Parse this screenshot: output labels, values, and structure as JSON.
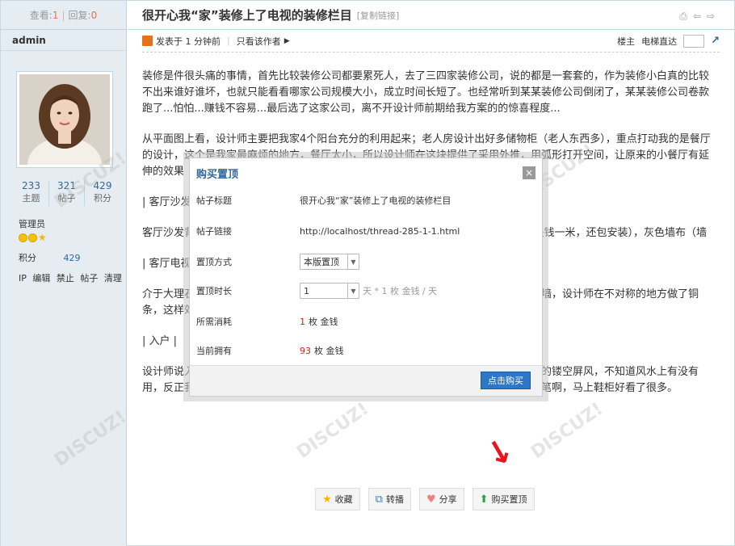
{
  "stats_bar": {
    "view_label": "查看:",
    "view_count": "1",
    "sep": "|",
    "reply_label": "回复:",
    "reply_count": "0"
  },
  "author": {
    "name": "admin"
  },
  "profile": {
    "stats": [
      {
        "value": "233",
        "label": "主题"
      },
      {
        "value": "321",
        "label": "帖子"
      },
      {
        "value": "429",
        "label": "积分"
      }
    ],
    "group": "管理员",
    "points_label": "积分",
    "points_value": "429",
    "links": [
      "IP",
      "编辑",
      "禁止",
      "帖子",
      "清理"
    ]
  },
  "thread": {
    "title": "很开心我“家”装修上了电视的装修栏目",
    "copy_link": "[复制链接]"
  },
  "meta": {
    "posted": "发表于 1 分钟前",
    "sep": "|",
    "only_author": "只看该作者",
    "floor": "楼主",
    "elevator": "电梯直达"
  },
  "content": {
    "p1": "装修是件很头痛的事情，首先比较装修公司都要累死人，去了三四家装修公司，说的都是一套套的，作为装修小白真的比较不出来谁好谁坏，也就只能看看哪家公司规模大小，成立时间长短了。也经常听到某某装修公司倒闭了，某某装修公司卷款跑了...怕怕...赚钱不容易...最后选了这家公司，离不开设计师前期给我方案的的惊喜程度...",
    "p2": "从平面图上看，设计师主要把我家4个阳台充分的利用起来；老人房设计出好多储物柜（老人东西多），重点打动我的是餐厅的设计，这个是我家最麻烦的地方，餐厅太小，所以设计师在这块提供了采用外推，用弧形打开空间，让原来的小餐厅有延伸的效果",
    "h1": "| 客厅沙发",
    "p3": "客厅沙发背景墙，设计师用了一种比较便宜的材料，效果却很好，这种材料其实40多块钱一米，还包安装），灰色墙布（墙",
    "h2": "| 客厅电视",
    "p4": "介于大理石太贵，设计师推荐我用瓷砖做电视背景墙，并且根据我的需求，改为瓷砖上墙，设计师在不对称的地方做了铜条，这样效果更好，同时避免了瓷砖与墙面连接处的收口，以及延伸了餐厅",
    "h3": "| 入户 |",
    "p5": "设计师说入户的地方空间比较小，可以做一个镂空屏风，我根据设计师的要求做了铜制的镂空屏风，不知道风水上有没有用，反正我觉得挺好看。说一下鞋柜，设计师在鞋柜的边框上嵌了铜条，我感觉点睛之笔啊，马上鞋柜好看了很多。"
  },
  "actions": [
    {
      "label": "收藏",
      "icon": "star-icon"
    },
    {
      "label": "转播",
      "icon": "share-box-icon"
    },
    {
      "label": "分享",
      "icon": "heart-icon"
    },
    {
      "label": "购买置顶",
      "icon": "up-arrow-icon"
    }
  ],
  "dialog": {
    "title": "购买置顶",
    "close": "×",
    "thread_title_label": "帖子标题",
    "thread_title_value": "很开心我“家”装修上了电视的装修栏目",
    "thread_link_label": "帖子链接",
    "thread_link_value": "http://localhost/thread-285-1-1.html",
    "mode_label": "置顶方式",
    "mode_value": "本版置顶",
    "duration_label": "置顶时长",
    "duration_value": "1",
    "duration_unit": "天 * 1 枚 金钱 / 天",
    "cost_label": "所需消耗",
    "cost_value": "1",
    "cost_unit": "枚 金钱",
    "have_label": "当前拥有",
    "have_value": "93",
    "have_unit": "枚 金钱",
    "buy_button": "点击购买"
  },
  "colors": {
    "accent": "#336699",
    "red": "#e8161a",
    "button": "#2d76c8"
  }
}
